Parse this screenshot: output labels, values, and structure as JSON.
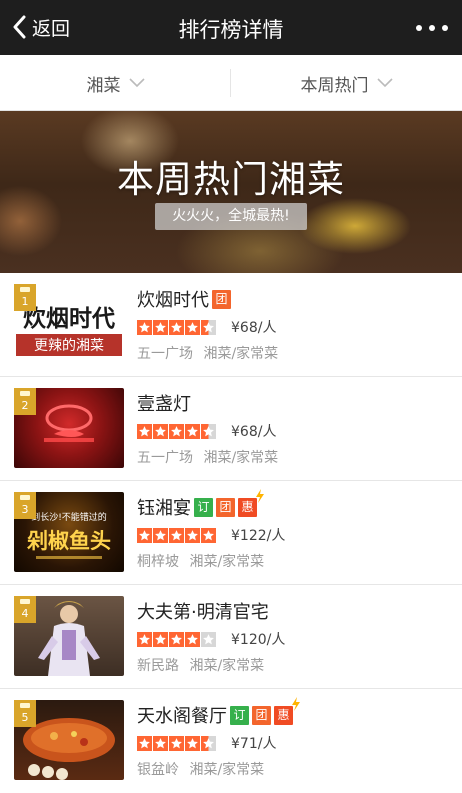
{
  "nav": {
    "back_label": "返回",
    "title": "排行榜详情"
  },
  "filters": {
    "cuisine": "湘菜",
    "period": "本周热门"
  },
  "banner": {
    "title": "本周热门湘菜",
    "subtitle": "火火火，全城最热!"
  },
  "restaurants": [
    {
      "rank": "1",
      "name": "炊烟时代",
      "rating": 4.5,
      "price": "¥68/人",
      "area": "五一广场",
      "category": "湘菜/家常菜",
      "tags": [
        "团"
      ],
      "thumb_text_1": "炊烟时代",
      "thumb_text_2": "更辣的湘菜"
    },
    {
      "rank": "2",
      "name": "壹盏灯",
      "rating": 4.5,
      "price": "¥68/人",
      "area": "五一广场",
      "category": "湘菜/家常菜",
      "tags": []
    },
    {
      "rank": "3",
      "name": "钰湘宴",
      "rating": 5,
      "price": "¥122/人",
      "area": "桐梓坡",
      "category": "湘菜/家常菜",
      "tags": [
        "订",
        "团",
        "惠"
      ],
      "thumb_text_1": "到长沙!不能错过的",
      "thumb_text_2": "剁椒鱼头"
    },
    {
      "rank": "4",
      "name": "大夫第·明清官宅",
      "rating": 4,
      "price": "¥120/人",
      "area": "新民路",
      "category": "湘菜/家常菜",
      "tags": []
    },
    {
      "rank": "5",
      "name": "天水阁餐厅",
      "rating": 4.5,
      "price": "¥71/人",
      "area": "银盆岭",
      "category": "湘菜/家常菜",
      "tags": [
        "订",
        "团",
        "惠"
      ]
    }
  ],
  "colors": {
    "navbar": "#1e1e1e",
    "star_on": "#ff6633",
    "star_off": "#d7d7d7",
    "rank_badge": "#d9a52a",
    "tag_tuan": "#f3652c",
    "tag_ding": "#36b04c",
    "tag_hui": "#f04b23"
  }
}
